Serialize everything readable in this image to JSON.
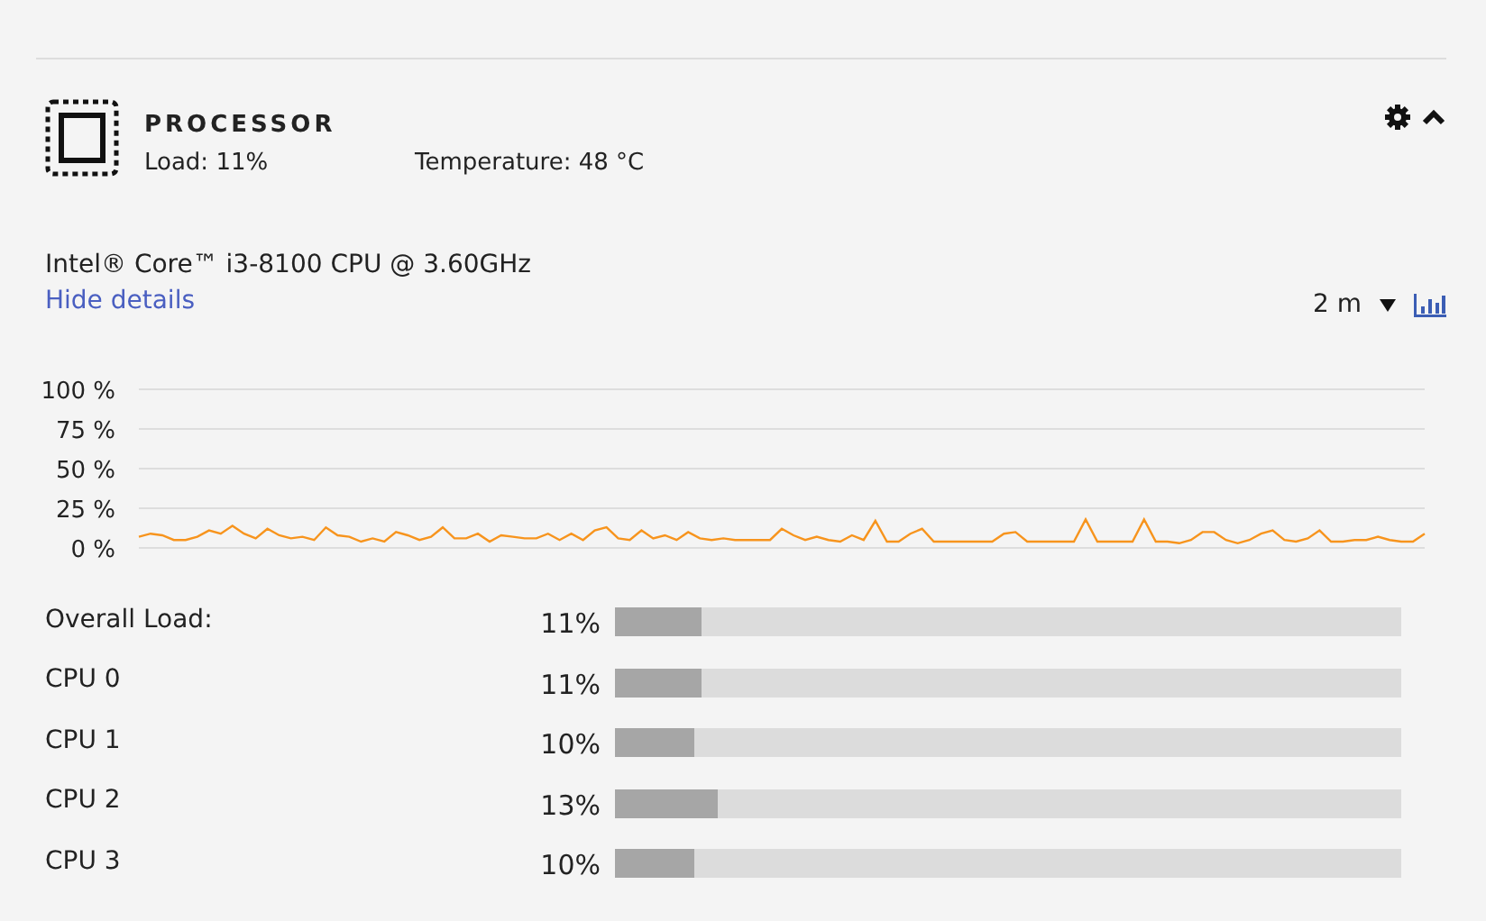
{
  "processor": {
    "title": "PROCESSOR",
    "load": "Load: 11%",
    "temperature": "Temperature: 48 °C",
    "expanded": true,
    "cpu_name": "Intel® Core™ i3-8100 CPU @ 3.60GHz",
    "details_link": "Hide details",
    "range": "2 m",
    "chart_data": {
      "type": "line",
      "grid": true,
      "ylim": [
        0,
        100
      ],
      "yticks": [
        {
          "value": 100,
          "label": "100 %"
        },
        {
          "value": 75,
          "label": "75 %"
        },
        {
          "value": 50,
          "label": "50 %"
        },
        {
          "value": 25,
          "label": "25 %"
        },
        {
          "value": 0,
          "label": "0 %"
        }
      ],
      "series": [
        {
          "color": "#f7941d",
          "values": [
            7,
            9,
            8,
            5,
            5,
            7,
            11,
            9,
            14,
            9,
            6,
            12,
            8,
            6,
            7,
            5,
            13,
            8,
            7,
            4,
            6,
            4,
            10,
            8,
            5,
            7,
            13,
            6,
            6,
            9,
            4,
            8,
            7,
            6,
            6,
            9,
            5,
            9,
            5,
            11,
            13,
            6,
            5,
            11,
            6,
            8,
            5,
            10,
            6,
            5,
            6,
            5,
            5,
            5,
            5,
            12,
            8,
            5,
            7,
            5,
            4,
            8,
            5,
            17,
            4,
            4,
            9,
            12,
            4,
            4,
            4,
            4,
            4,
            4,
            9,
            10,
            4,
            4,
            4,
            4,
            4,
            18,
            4,
            4,
            4,
            4,
            18,
            4,
            4,
            3,
            5,
            10,
            10,
            5,
            3,
            5,
            9,
            11,
            5,
            4,
            6,
            11,
            4,
            4,
            5,
            5,
            7,
            5,
            4,
            4,
            9
          ]
        }
      ]
    },
    "rows": [
      {
        "label": "Overall Load:",
        "value": "11%",
        "level": 0.11
      },
      {
        "label": "CPU 0",
        "value": "11%",
        "level": 0.11
      },
      {
        "label": "CPU 1",
        "value": "10%",
        "level": 0.1
      },
      {
        "label": "CPU 2",
        "value": "13%",
        "level": 0.13
      },
      {
        "label": "CPU 3",
        "value": "10%",
        "level": 0.1
      }
    ]
  }
}
